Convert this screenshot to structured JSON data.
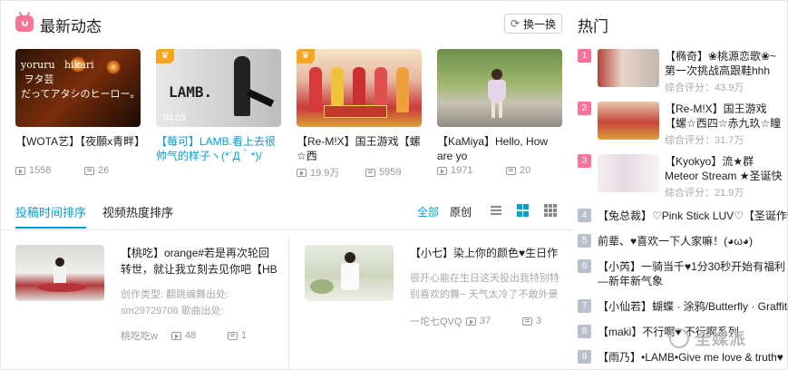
{
  "header": {
    "title": "最新动态",
    "swap_label": "换一换"
  },
  "videos": [
    {
      "title": "【WOTA艺】【夜願x青畔】",
      "plays": "1558",
      "danmaku": "26",
      "overlay": "yoruru   hikari\n ヲタ芸\nだってアタシのヒーロー。",
      "title_link": false
    },
    {
      "title": "【莓可】LAMB.看上去很帅气的样子ヽ(*´Д｀*)/",
      "plays": "",
      "danmaku": "",
      "overlay": "LAMB.",
      "duration": "04:03",
      "title_link": true
    },
    {
      "title": "【Re-M!X】国王游戏【螺☆西",
      "plays": "19.9万",
      "danmaku": "5959",
      "overlay": "",
      "title_link": false
    },
    {
      "title": "【KaMiya】Hello, How are yo",
      "plays": "1971",
      "danmaku": "20",
      "overlay": "",
      "title_link": false
    }
  ],
  "tabs": {
    "items": [
      "投稿时间排序",
      "视频热度排序"
    ],
    "active": 0
  },
  "filters": {
    "all": "全部",
    "original": "原创"
  },
  "posts": [
    {
      "title": "【桃吃】orange#若是再次轮回转世，就让我立刻去见你吧【HB to 不二",
      "desc": "创作类型: 翻跳编舞出处: sm29729708 歌曲出处: sm19625630 摄影: 年后",
      "author": "桃吃吃w",
      "plays": "48",
      "danmaku": "1"
    },
    {
      "title": "【小七】染上你的颜色♥生日作♥",
      "desc": "很开心能在生日这天投出我特别特别喜欢的舞~ 天气太冷了不敢外景了于",
      "author": "一坨七QVQ",
      "plays": "37",
      "danmaku": "3"
    }
  ],
  "hot": {
    "title": "热门",
    "score_label": "综合评分：",
    "top": [
      {
        "rank": "1",
        "title": "【椭奇】❀桃源恋歌❀~第一次挑战高跟鞋hhh",
        "score": "43.9万"
      },
      {
        "rank": "2",
        "title": "【Re-M!X】国王游戏【螺☆西四☆赤九玖☆瞳☆浩】第",
        "score": "31.7万"
      },
      {
        "rank": "3",
        "title": "【Kyokyo】流★群 Meteor Stream ★圣诞快乐！",
        "score": "21.9万"
      }
    ],
    "rest": [
      {
        "rank": "4",
        "title": "【兔总裁】♡Pink Stick LUV♡【圣诞作♥】"
      },
      {
        "rank": "5",
        "title": "前辈、♥喜欢一下人家嘛！(◕ω◕)"
      },
      {
        "rank": "6",
        "title": "【小芮】一骑当千♥1分30秒开始有福利—新年新气象"
      },
      {
        "rank": "7",
        "title": "【小仙若】蝴蝶 · 涂鸦/Butterfly · Graffiti"
      },
      {
        "rank": "8",
        "title": "【maki】不行啊♥ 不行啊系列"
      },
      {
        "rank": "9",
        "title": "【雨乃】•LAMB•Give me love & truth♥"
      }
    ]
  },
  "watermark": "全媒派",
  "colors": {
    "accent": "#00a1d6",
    "pink": "#fb7299"
  }
}
